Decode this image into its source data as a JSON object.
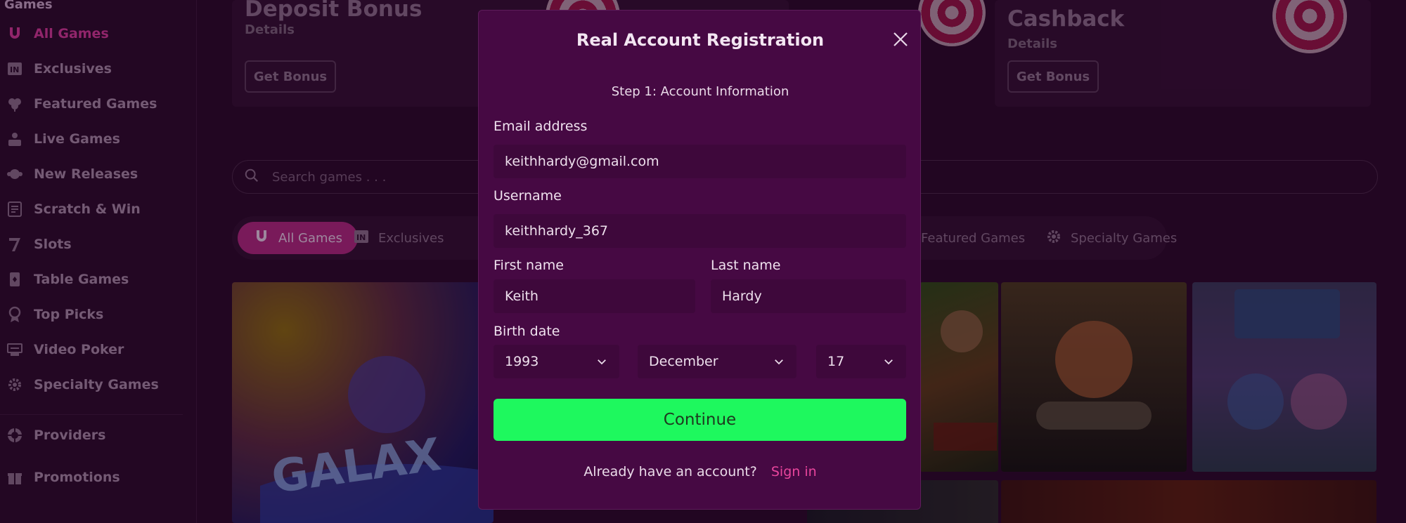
{
  "sidebar": {
    "section_title": "Games",
    "items": [
      {
        "label": "All Games",
        "icon": "horseshoe-icon"
      },
      {
        "label": "Exclusives",
        "icon": "exclusive-badge-icon"
      },
      {
        "label": "Featured Games",
        "icon": "clover-icon"
      },
      {
        "label": "Live Games",
        "icon": "dealer-icon"
      },
      {
        "label": "New Releases",
        "icon": "sparkle-icon"
      },
      {
        "label": "Scratch & Win",
        "icon": "scratch-card-icon"
      },
      {
        "label": "Slots",
        "icon": "seven-icon"
      },
      {
        "label": "Table Games",
        "icon": "cards-icon"
      },
      {
        "label": "Top Picks",
        "icon": "medal-icon"
      },
      {
        "label": "Video Poker",
        "icon": "poker-machine-icon"
      },
      {
        "label": "Specialty Games",
        "icon": "gear-icon"
      },
      {
        "label": "Providers",
        "icon": "chip-icon"
      },
      {
        "label": "Promotions",
        "icon": "gift-icon"
      }
    ]
  },
  "promos": [
    {
      "title": "Deposit Bonus",
      "details": "Details",
      "button": "Get Bonus"
    },
    {
      "title": "Cashback",
      "details": "Details",
      "button": "Get Bonus"
    }
  ],
  "search": {
    "placeholder": "Search games . . ."
  },
  "chips": [
    {
      "label": "All Games",
      "icon": "horseshoe-icon"
    },
    {
      "label": "Exclusives",
      "icon": "exclusive-badge-icon"
    },
    {
      "label": "Featured Games",
      "icon": "clover-icon"
    },
    {
      "label": "Specialty Games",
      "icon": "gear-icon"
    }
  ],
  "modal": {
    "title": "Real Account Registration",
    "step": "Step 1: Account Information",
    "email_label": "Email address",
    "email_value": "keithhardy@gmail.com",
    "username_label": "Username",
    "username_value": "keithhardy_367",
    "first_name_label": "First name",
    "first_name_value": "Keith",
    "last_name_label": "Last name",
    "last_name_value": "Hardy",
    "birth_label": "Birth date",
    "birth_year": "1993",
    "birth_month": "December",
    "birth_day": "17",
    "continue_label": "Continue",
    "account_prompt": "Already have an account?",
    "signin_label": "Sign in"
  },
  "colors": {
    "accent": "#d43a9a",
    "continue": "#1ef85e",
    "modal_bg": "#460943"
  }
}
